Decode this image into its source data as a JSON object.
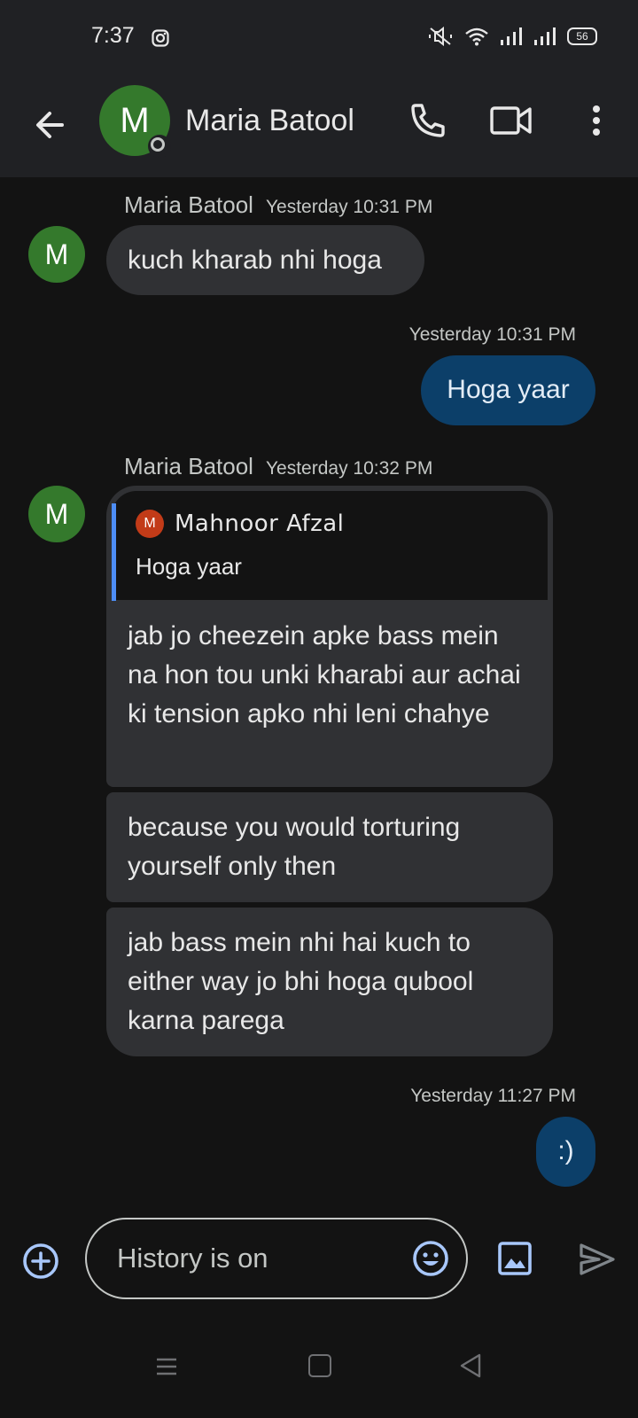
{
  "status_bar": {
    "time": "7:37",
    "battery": "56",
    "icons": [
      "instagram-icon",
      "mute-icon",
      "wifi-icon",
      "signal-icon",
      "signal-icon",
      "battery-icon"
    ]
  },
  "header": {
    "contact_name": "Maria Batool",
    "avatar_initial": "M",
    "avatar_color": "#34792c",
    "icons": [
      "back-arrow-icon",
      "phone-icon",
      "video-call-icon",
      "more-vert-icon"
    ]
  },
  "messages": [
    {
      "direction": "in",
      "sender": "Maria Batool",
      "time": "Yesterday 10:31 PM",
      "avatar": "M",
      "text": "kuch kharab nhi hoga"
    },
    {
      "direction": "out",
      "time": "Yesterday 10:31 PM",
      "text": "Hoga yaar"
    },
    {
      "direction": "in",
      "sender": "Maria Batool",
      "time": "Yesterday 10:32 PM",
      "avatar": "M",
      "reply_to": {
        "avatar": "M",
        "name": "Mahnoor Afzal",
        "text": "Hoga yaar"
      },
      "text": "jab jo cheezein apke bass mein na hon tou unki kharabi aur achai ki tension apko nhi leni chahye"
    },
    {
      "direction": "in",
      "text": "because you would torturing yourself only then"
    },
    {
      "direction": "in",
      "text": "jab bass mein nhi hai kuch to either way jo bhi hoga qubool karna parega"
    },
    {
      "direction": "out",
      "time": "Yesterday 11:27 PM",
      "text": ":)"
    }
  ],
  "composer": {
    "placeholder": "History is on",
    "icons": [
      "add-circle-icon",
      "emoji-icon",
      "gallery-icon",
      "send-icon"
    ]
  },
  "colors": {
    "incoming_bubble": "#303134",
    "outgoing_bubble": "#0c3f69",
    "accent": "#a8c7fa",
    "quote_bar": "#4d8df6"
  }
}
